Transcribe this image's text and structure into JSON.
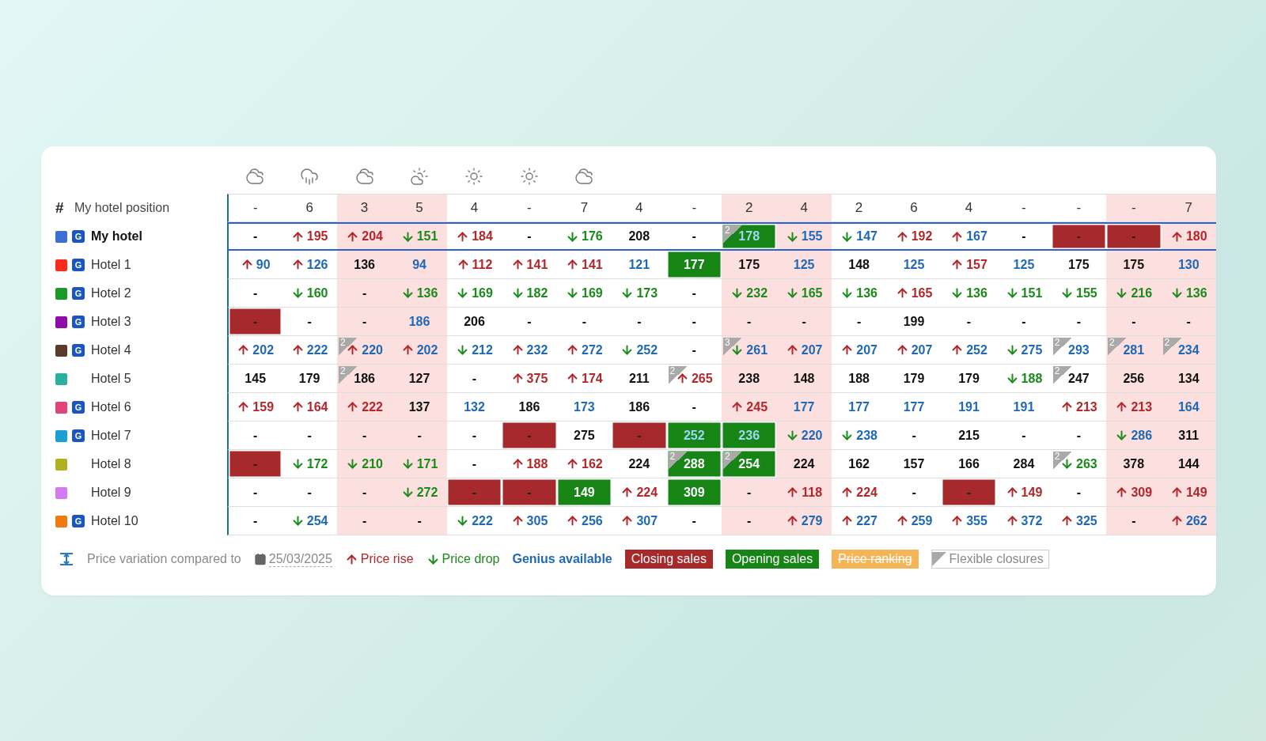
{
  "weather": [
    {
      "kind": "cloudy"
    },
    {
      "kind": "rain"
    },
    {
      "kind": "cloudy"
    },
    {
      "kind": "sun-cloud"
    },
    {
      "kind": "sun"
    },
    {
      "kind": "sun"
    },
    {
      "kind": "cloudy"
    }
  ],
  "columns": [
    {
      "weekend": false
    },
    {
      "weekend": false
    },
    {
      "weekend": true
    },
    {
      "weekend": true
    },
    {
      "weekend": false
    },
    {
      "weekend": false
    },
    {
      "weekend": false
    },
    {
      "weekend": false
    },
    {
      "weekend": false
    },
    {
      "weekend": true
    },
    {
      "weekend": true
    },
    {
      "weekend": false
    },
    {
      "weekend": false
    },
    {
      "weekend": false
    },
    {
      "weekend": false
    },
    {
      "weekend": false
    },
    {
      "weekend": true
    },
    {
      "weekend": true
    }
  ],
  "position_row": {
    "symbol": "#",
    "label": "My hotel position",
    "values": [
      "-",
      "6",
      "3",
      "5",
      "4",
      "-",
      "7",
      "4",
      "-",
      "2",
      "4",
      "2",
      "6",
      "4",
      "-",
      "-",
      "-",
      "7"
    ]
  },
  "hotels": [
    {
      "name": "My hotel",
      "color": "#3b6fd6",
      "badge": "G",
      "highlighted": true,
      "cells": [
        {
          "price": "-",
          "rise": false,
          "drop": false,
          "genius": false,
          "closed": false,
          "opened": false
        },
        {
          "price": "195",
          "rise": true,
          "drop": false,
          "genius": false,
          "closed": false,
          "opened": false
        },
        {
          "price": "204",
          "rise": true,
          "drop": false,
          "genius": false,
          "closed": false,
          "opened": false
        },
        {
          "price": "151",
          "rise": false,
          "drop": true,
          "genius": false,
          "closed": false,
          "opened": false
        },
        {
          "price": "184",
          "rise": true,
          "drop": false,
          "genius": false,
          "closed": false,
          "opened": false
        },
        {
          "price": "-",
          "rise": false,
          "drop": false,
          "genius": false,
          "closed": false,
          "opened": false
        },
        {
          "price": "176",
          "rise": false,
          "drop": true,
          "genius": false,
          "closed": false,
          "opened": false
        },
        {
          "price": "208",
          "rise": false,
          "drop": false,
          "genius": false,
          "closed": false,
          "opened": false
        },
        {
          "price": "-",
          "rise": false,
          "drop": false,
          "genius": false,
          "closed": false,
          "opened": false
        },
        {
          "price": "178",
          "rise": false,
          "drop": false,
          "genius": true,
          "closed": false,
          "opened": true,
          "flex": "2"
        },
        {
          "price": "155",
          "rise": false,
          "drop": true,
          "genius": true,
          "closed": false,
          "opened": false
        },
        {
          "price": "147",
          "rise": false,
          "drop": true,
          "genius": true,
          "closed": false,
          "opened": false
        },
        {
          "price": "192",
          "rise": true,
          "drop": false,
          "genius": false,
          "closed": false,
          "opened": false
        },
        {
          "price": "167",
          "rise": true,
          "drop": false,
          "genius": true,
          "closed": false,
          "opened": false
        },
        {
          "price": "-",
          "rise": false,
          "drop": false,
          "genius": false,
          "closed": false,
          "opened": false
        },
        {
          "price": "-",
          "rise": false,
          "drop": false,
          "genius": false,
          "closed": true,
          "opened": false
        },
        {
          "price": "-",
          "rise": false,
          "drop": false,
          "genius": false,
          "closed": true,
          "opened": false
        },
        {
          "price": "180",
          "rise": true,
          "drop": false,
          "genius": false,
          "closed": false,
          "opened": false
        }
      ]
    },
    {
      "name": "Hotel 1",
      "color": "#ff2a1a",
      "badge": "G",
      "highlighted": false,
      "cells": [
        {
          "price": "90",
          "rise": true,
          "drop": false,
          "genius": true,
          "closed": false,
          "opened": false
        },
        {
          "price": "126",
          "rise": true,
          "drop": false,
          "genius": true,
          "closed": false,
          "opened": false
        },
        {
          "price": "136",
          "rise": false,
          "drop": false,
          "genius": false,
          "closed": false,
          "opened": false
        },
        {
          "price": "94",
          "rise": false,
          "drop": false,
          "genius": true,
          "closed": false,
          "opened": false
        },
        {
          "price": "112",
          "rise": true,
          "drop": false,
          "genius": false,
          "closed": false,
          "opened": false
        },
        {
          "price": "141",
          "rise": true,
          "drop": false,
          "genius": false,
          "closed": false,
          "opened": false
        },
        {
          "price": "141",
          "rise": true,
          "drop": false,
          "genius": false,
          "closed": false,
          "opened": false
        },
        {
          "price": "121",
          "rise": false,
          "drop": false,
          "genius": true,
          "closed": false,
          "opened": false
        },
        {
          "price": "177",
          "rise": false,
          "drop": false,
          "genius": false,
          "closed": false,
          "opened": true
        },
        {
          "price": "175",
          "rise": false,
          "drop": false,
          "genius": false,
          "closed": false,
          "opened": false
        },
        {
          "price": "125",
          "rise": false,
          "drop": false,
          "genius": true,
          "closed": false,
          "opened": false
        },
        {
          "price": "148",
          "rise": false,
          "drop": false,
          "genius": false,
          "closed": false,
          "opened": false
        },
        {
          "price": "125",
          "rise": false,
          "drop": false,
          "genius": true,
          "closed": false,
          "opened": false
        },
        {
          "price": "157",
          "rise": true,
          "drop": false,
          "genius": false,
          "closed": false,
          "opened": false
        },
        {
          "price": "125",
          "rise": false,
          "drop": false,
          "genius": true,
          "closed": false,
          "opened": false
        },
        {
          "price": "175",
          "rise": false,
          "drop": false,
          "genius": false,
          "closed": false,
          "opened": false
        },
        {
          "price": "175",
          "rise": false,
          "drop": false,
          "genius": false,
          "closed": false,
          "opened": false
        },
        {
          "price": "130",
          "rise": false,
          "drop": false,
          "genius": true,
          "closed": false,
          "opened": false
        }
      ]
    },
    {
      "name": "Hotel 2",
      "color": "#1a9a28",
      "badge": "G",
      "highlighted": false,
      "cells": [
        {
          "price": "-",
          "rise": false,
          "drop": false,
          "genius": false,
          "closed": false,
          "opened": false
        },
        {
          "price": "160",
          "rise": false,
          "drop": true,
          "genius": false,
          "closed": false,
          "opened": false
        },
        {
          "price": "-",
          "rise": false,
          "drop": false,
          "genius": false,
          "closed": false,
          "opened": false
        },
        {
          "price": "136",
          "rise": false,
          "drop": true,
          "genius": false,
          "closed": false,
          "opened": false
        },
        {
          "price": "169",
          "rise": false,
          "drop": true,
          "genius": false,
          "closed": false,
          "opened": false
        },
        {
          "price": "182",
          "rise": false,
          "drop": true,
          "genius": false,
          "closed": false,
          "opened": false
        },
        {
          "price": "169",
          "rise": false,
          "drop": true,
          "genius": false,
          "closed": false,
          "opened": false
        },
        {
          "price": "173",
          "rise": false,
          "drop": true,
          "genius": false,
          "closed": false,
          "opened": false
        },
        {
          "price": "-",
          "rise": false,
          "drop": false,
          "genius": false,
          "closed": false,
          "opened": false
        },
        {
          "price": "232",
          "rise": false,
          "drop": true,
          "genius": false,
          "closed": false,
          "opened": false
        },
        {
          "price": "165",
          "rise": false,
          "drop": true,
          "genius": false,
          "closed": false,
          "opened": false
        },
        {
          "price": "136",
          "rise": false,
          "drop": true,
          "genius": false,
          "closed": false,
          "opened": false
        },
        {
          "price": "165",
          "rise": true,
          "drop": false,
          "genius": false,
          "closed": false,
          "opened": false
        },
        {
          "price": "136",
          "rise": false,
          "drop": true,
          "genius": false,
          "closed": false,
          "opened": false
        },
        {
          "price": "151",
          "rise": false,
          "drop": true,
          "genius": false,
          "closed": false,
          "opened": false
        },
        {
          "price": "155",
          "rise": false,
          "drop": true,
          "genius": false,
          "closed": false,
          "opened": false
        },
        {
          "price": "216",
          "rise": false,
          "drop": true,
          "genius": false,
          "closed": false,
          "opened": false
        },
        {
          "price": "136",
          "rise": false,
          "drop": true,
          "genius": false,
          "closed": false,
          "opened": false
        }
      ]
    },
    {
      "name": "Hotel 3",
      "color": "#8e0ca8",
      "badge": "G",
      "highlighted": false,
      "cells": [
        {
          "price": "-",
          "rise": false,
          "drop": false,
          "genius": false,
          "closed": true,
          "opened": false
        },
        {
          "price": "-",
          "rise": false,
          "drop": false,
          "genius": false,
          "closed": false,
          "opened": false
        },
        {
          "price": "-",
          "rise": false,
          "drop": false,
          "genius": false,
          "closed": false,
          "opened": false
        },
        {
          "price": "186",
          "rise": false,
          "drop": false,
          "genius": true,
          "closed": false,
          "opened": false
        },
        {
          "price": "206",
          "rise": false,
          "drop": false,
          "genius": false,
          "closed": false,
          "opened": false
        },
        {
          "price": "-",
          "rise": false,
          "drop": false,
          "genius": false,
          "closed": false,
          "opened": false
        },
        {
          "price": "-",
          "rise": false,
          "drop": false,
          "genius": false,
          "closed": false,
          "opened": false
        },
        {
          "price": "-",
          "rise": false,
          "drop": false,
          "genius": false,
          "closed": false,
          "opened": false
        },
        {
          "price": "-",
          "rise": false,
          "drop": false,
          "genius": false,
          "closed": false,
          "opened": false
        },
        {
          "price": "-",
          "rise": false,
          "drop": false,
          "genius": false,
          "closed": false,
          "opened": false
        },
        {
          "price": "-",
          "rise": false,
          "drop": false,
          "genius": false,
          "closed": false,
          "opened": false
        },
        {
          "price": "-",
          "rise": false,
          "drop": false,
          "genius": false,
          "closed": false,
          "opened": false
        },
        {
          "price": "199",
          "rise": false,
          "drop": false,
          "genius": false,
          "closed": false,
          "opened": false
        },
        {
          "price": "-",
          "rise": false,
          "drop": false,
          "genius": false,
          "closed": false,
          "opened": false
        },
        {
          "price": "-",
          "rise": false,
          "drop": false,
          "genius": false,
          "closed": false,
          "opened": false
        },
        {
          "price": "-",
          "rise": false,
          "drop": false,
          "genius": false,
          "closed": false,
          "opened": false
        },
        {
          "price": "-",
          "rise": false,
          "drop": false,
          "genius": false,
          "closed": false,
          "opened": false
        },
        {
          "price": "-",
          "rise": false,
          "drop": false,
          "genius": false,
          "closed": false,
          "opened": false
        }
      ]
    },
    {
      "name": "Hotel 4",
      "color": "#5a3a2a",
      "badge": "G",
      "highlighted": false,
      "cells": [
        {
          "price": "202",
          "rise": true,
          "drop": false,
          "genius": true,
          "closed": false,
          "opened": false
        },
        {
          "price": "222",
          "rise": true,
          "drop": false,
          "genius": true,
          "closed": false,
          "opened": false
        },
        {
          "price": "220",
          "rise": true,
          "drop": false,
          "genius": true,
          "closed": false,
          "opened": false,
          "flex": "2"
        },
        {
          "price": "202",
          "rise": true,
          "drop": false,
          "genius": true,
          "closed": false,
          "opened": false
        },
        {
          "price": "212",
          "rise": false,
          "drop": true,
          "genius": true,
          "closed": false,
          "opened": false
        },
        {
          "price": "232",
          "rise": true,
          "drop": false,
          "genius": true,
          "closed": false,
          "opened": false
        },
        {
          "price": "272",
          "rise": true,
          "drop": false,
          "genius": true,
          "closed": false,
          "opened": false
        },
        {
          "price": "252",
          "rise": false,
          "drop": true,
          "genius": true,
          "closed": false,
          "opened": false
        },
        {
          "price": "-",
          "rise": false,
          "drop": false,
          "genius": false,
          "closed": false,
          "opened": false
        },
        {
          "price": "261",
          "rise": false,
          "drop": true,
          "genius": true,
          "closed": false,
          "opened": false,
          "flex": "3"
        },
        {
          "price": "207",
          "rise": true,
          "drop": false,
          "genius": true,
          "closed": false,
          "opened": false
        },
        {
          "price": "207",
          "rise": true,
          "drop": false,
          "genius": true,
          "closed": false,
          "opened": false
        },
        {
          "price": "207",
          "rise": true,
          "drop": false,
          "genius": true,
          "closed": false,
          "opened": false
        },
        {
          "price": "252",
          "rise": true,
          "drop": false,
          "genius": true,
          "closed": false,
          "opened": false
        },
        {
          "price": "275",
          "rise": false,
          "drop": true,
          "genius": true,
          "closed": false,
          "opened": false
        },
        {
          "price": "293",
          "rise": false,
          "drop": false,
          "genius": true,
          "closed": false,
          "opened": false,
          "flex": "2"
        },
        {
          "price": "281",
          "rise": false,
          "drop": false,
          "genius": true,
          "closed": false,
          "opened": false,
          "flex": "2"
        },
        {
          "price": "234",
          "rise": false,
          "drop": false,
          "genius": true,
          "closed": false,
          "opened": false,
          "flex": "2"
        }
      ]
    },
    {
      "name": "Hotel 5",
      "color": "#2ab0a0",
      "highlighted": false,
      "cells": [
        {
          "price": "145",
          "rise": false,
          "drop": false,
          "genius": false,
          "closed": false,
          "opened": false
        },
        {
          "price": "179",
          "rise": false,
          "drop": false,
          "genius": false,
          "closed": false,
          "opened": false
        },
        {
          "price": "186",
          "rise": false,
          "drop": false,
          "genius": false,
          "closed": false,
          "opened": false,
          "flex": "2"
        },
        {
          "price": "127",
          "rise": false,
          "drop": false,
          "genius": false,
          "closed": false,
          "opened": false
        },
        {
          "price": "-",
          "rise": false,
          "drop": false,
          "genius": false,
          "closed": false,
          "opened": false
        },
        {
          "price": "375",
          "rise": true,
          "drop": false,
          "genius": false,
          "closed": false,
          "opened": false
        },
        {
          "price": "174",
          "rise": true,
          "drop": false,
          "genius": false,
          "closed": false,
          "opened": false
        },
        {
          "price": "211",
          "rise": false,
          "drop": false,
          "genius": false,
          "closed": false,
          "opened": false
        },
        {
          "price": "265",
          "rise": true,
          "drop": false,
          "genius": false,
          "closed": false,
          "opened": false,
          "flex": "2"
        },
        {
          "price": "238",
          "rise": false,
          "drop": false,
          "genius": false,
          "closed": false,
          "opened": false
        },
        {
          "price": "148",
          "rise": false,
          "drop": false,
          "genius": false,
          "closed": false,
          "opened": false
        },
        {
          "price": "188",
          "rise": false,
          "drop": false,
          "genius": false,
          "closed": false,
          "opened": false
        },
        {
          "price": "179",
          "rise": false,
          "drop": false,
          "genius": false,
          "closed": false,
          "opened": false
        },
        {
          "price": "179",
          "rise": false,
          "drop": false,
          "genius": false,
          "closed": false,
          "opened": false
        },
        {
          "price": "188",
          "rise": false,
          "drop": true,
          "genius": false,
          "closed": false,
          "opened": false
        },
        {
          "price": "247",
          "rise": false,
          "drop": false,
          "genius": false,
          "closed": false,
          "opened": false,
          "flex": "2"
        },
        {
          "price": "256",
          "rise": false,
          "drop": false,
          "genius": false,
          "closed": false,
          "opened": false
        },
        {
          "price": "134",
          "rise": false,
          "drop": false,
          "genius": false,
          "closed": false,
          "opened": false
        }
      ]
    },
    {
      "name": "Hotel 6",
      "color": "#e0457a",
      "badge": "G",
      "highlighted": false,
      "cells": [
        {
          "price": "159",
          "rise": true,
          "drop": false,
          "genius": false,
          "closed": false,
          "opened": false
        },
        {
          "price": "164",
          "rise": true,
          "drop": false,
          "genius": false,
          "closed": false,
          "opened": false
        },
        {
          "price": "222",
          "rise": true,
          "drop": false,
          "genius": false,
          "closed": false,
          "opened": false
        },
        {
          "price": "137",
          "rise": false,
          "drop": false,
          "genius": false,
          "closed": false,
          "opened": false
        },
        {
          "price": "132",
          "rise": false,
          "drop": false,
          "genius": true,
          "closed": false,
          "opened": false
        },
        {
          "price": "186",
          "rise": false,
          "drop": false,
          "genius": false,
          "closed": false,
          "opened": false
        },
        {
          "price": "173",
          "rise": false,
          "drop": false,
          "genius": true,
          "closed": false,
          "opened": false
        },
        {
          "price": "186",
          "rise": false,
          "drop": false,
          "genius": false,
          "closed": false,
          "opened": false
        },
        {
          "price": "-",
          "rise": false,
          "drop": false,
          "genius": false,
          "closed": false,
          "opened": false
        },
        {
          "price": "245",
          "rise": true,
          "drop": false,
          "genius": false,
          "closed": false,
          "opened": false
        },
        {
          "price": "177",
          "rise": false,
          "drop": false,
          "genius": true,
          "closed": false,
          "opened": false
        },
        {
          "price": "177",
          "rise": false,
          "drop": false,
          "genius": true,
          "closed": false,
          "opened": false
        },
        {
          "price": "177",
          "rise": false,
          "drop": false,
          "genius": true,
          "closed": false,
          "opened": false
        },
        {
          "price": "191",
          "rise": false,
          "drop": false,
          "genius": true,
          "closed": false,
          "opened": false
        },
        {
          "price": "191",
          "rise": false,
          "drop": false,
          "genius": true,
          "closed": false,
          "opened": false
        },
        {
          "price": "213",
          "rise": true,
          "drop": false,
          "genius": false,
          "closed": false,
          "opened": false
        },
        {
          "price": "213",
          "rise": true,
          "drop": false,
          "genius": false,
          "closed": false,
          "opened": false
        },
        {
          "price": "164",
          "rise": false,
          "drop": false,
          "genius": true,
          "closed": false,
          "opened": false
        }
      ]
    },
    {
      "name": "Hotel 7",
      "color": "#1aa0d0",
      "badge": "G",
      "highlighted": false,
      "cells": [
        {
          "price": "-",
          "rise": false,
          "drop": false,
          "genius": false,
          "closed": false,
          "opened": false
        },
        {
          "price": "-",
          "rise": false,
          "drop": false,
          "genius": false,
          "closed": false,
          "opened": false
        },
        {
          "price": "-",
          "rise": false,
          "drop": false,
          "genius": false,
          "closed": false,
          "opened": false
        },
        {
          "price": "-",
          "rise": false,
          "drop": false,
          "genius": false,
          "closed": false,
          "opened": false
        },
        {
          "price": "-",
          "rise": false,
          "drop": false,
          "genius": false,
          "closed": false,
          "opened": false
        },
        {
          "price": "-",
          "rise": false,
          "drop": false,
          "genius": false,
          "closed": true,
          "opened": false
        },
        {
          "price": "275",
          "rise": false,
          "drop": false,
          "genius": false,
          "closed": false,
          "opened": false
        },
        {
          "price": "-",
          "rise": false,
          "drop": false,
          "genius": false,
          "closed": true,
          "opened": false
        },
        {
          "price": "252",
          "rise": false,
          "drop": false,
          "genius": true,
          "closed": false,
          "opened": true
        },
        {
          "price": "236",
          "rise": false,
          "drop": false,
          "genius": true,
          "closed": false,
          "opened": true
        },
        {
          "price": "220",
          "rise": false,
          "drop": true,
          "genius": true,
          "closed": false,
          "opened": false
        },
        {
          "price": "238",
          "rise": false,
          "drop": true,
          "genius": true,
          "closed": false,
          "opened": false
        },
        {
          "price": "-",
          "rise": false,
          "drop": false,
          "genius": false,
          "closed": false,
          "opened": false
        },
        {
          "price": "215",
          "rise": false,
          "drop": false,
          "genius": false,
          "closed": false,
          "opened": false
        },
        {
          "price": "-",
          "rise": false,
          "drop": false,
          "genius": false,
          "closed": false,
          "opened": false
        },
        {
          "price": "-",
          "rise": false,
          "drop": false,
          "genius": false,
          "closed": false,
          "opened": false
        },
        {
          "price": "286",
          "rise": false,
          "drop": true,
          "genius": true,
          "closed": false,
          "opened": false
        },
        {
          "price": "311",
          "rise": false,
          "drop": false,
          "genius": false,
          "closed": false,
          "opened": false
        }
      ]
    },
    {
      "name": "Hotel 8",
      "color": "#b0b020",
      "highlighted": false,
      "cells": [
        {
          "price": "-",
          "rise": false,
          "drop": false,
          "genius": false,
          "closed": true,
          "opened": false
        },
        {
          "price": "172",
          "rise": false,
          "drop": true,
          "genius": false,
          "closed": false,
          "opened": false
        },
        {
          "price": "210",
          "rise": false,
          "drop": true,
          "genius": false,
          "closed": false,
          "opened": false
        },
        {
          "price": "171",
          "rise": false,
          "drop": true,
          "genius": false,
          "closed": false,
          "opened": false
        },
        {
          "price": "-",
          "rise": false,
          "drop": false,
          "genius": false,
          "closed": false,
          "opened": false
        },
        {
          "price": "188",
          "rise": true,
          "drop": false,
          "genius": false,
          "closed": false,
          "opened": false
        },
        {
          "price": "162",
          "rise": true,
          "drop": false,
          "genius": false,
          "closed": false,
          "opened": false
        },
        {
          "price": "224",
          "rise": false,
          "drop": false,
          "genius": false,
          "closed": false,
          "opened": false
        },
        {
          "price": "288",
          "rise": false,
          "drop": false,
          "genius": false,
          "closed": false,
          "opened": true,
          "flex": "2"
        },
        {
          "price": "254",
          "rise": false,
          "drop": false,
          "genius": false,
          "closed": false,
          "opened": true,
          "flex": "2"
        },
        {
          "price": "224",
          "rise": false,
          "drop": false,
          "genius": false,
          "closed": false,
          "opened": false
        },
        {
          "price": "162",
          "rise": false,
          "drop": false,
          "genius": false,
          "closed": false,
          "opened": false
        },
        {
          "price": "157",
          "rise": false,
          "drop": false,
          "genius": false,
          "closed": false,
          "opened": false
        },
        {
          "price": "166",
          "rise": false,
          "drop": false,
          "genius": false,
          "closed": false,
          "opened": false
        },
        {
          "price": "284",
          "rise": false,
          "drop": false,
          "genius": false,
          "closed": false,
          "opened": false
        },
        {
          "price": "263",
          "rise": false,
          "drop": true,
          "genius": false,
          "closed": false,
          "opened": false,
          "flex": "2"
        },
        {
          "price": "378",
          "rise": false,
          "drop": false,
          "genius": false,
          "closed": false,
          "opened": false
        },
        {
          "price": "144",
          "rise": false,
          "drop": false,
          "genius": false,
          "closed": false,
          "opened": false
        }
      ]
    },
    {
      "name": "Hotel 9",
      "color": "#d47af0",
      "highlighted": false,
      "cells": [
        {
          "price": "-",
          "rise": false,
          "drop": false,
          "genius": false,
          "closed": false,
          "opened": false
        },
        {
          "price": "-",
          "rise": false,
          "drop": false,
          "genius": false,
          "closed": false,
          "opened": false
        },
        {
          "price": "-",
          "rise": false,
          "drop": false,
          "genius": false,
          "closed": false,
          "opened": false
        },
        {
          "price": "272",
          "rise": false,
          "drop": true,
          "genius": false,
          "closed": false,
          "opened": false
        },
        {
          "price": "-",
          "rise": false,
          "drop": false,
          "genius": false,
          "closed": true,
          "opened": false
        },
        {
          "price": "-",
          "rise": false,
          "drop": false,
          "genius": false,
          "closed": true,
          "opened": false
        },
        {
          "price": "149",
          "rise": false,
          "drop": false,
          "genius": false,
          "closed": false,
          "opened": true
        },
        {
          "price": "224",
          "rise": true,
          "drop": false,
          "genius": false,
          "closed": false,
          "opened": false
        },
        {
          "price": "309",
          "rise": false,
          "drop": false,
          "genius": false,
          "closed": false,
          "opened": true
        },
        {
          "price": "-",
          "rise": false,
          "drop": false,
          "genius": false,
          "closed": false,
          "opened": false
        },
        {
          "price": "118",
          "rise": true,
          "drop": false,
          "genius": false,
          "closed": false,
          "opened": false
        },
        {
          "price": "224",
          "rise": true,
          "drop": false,
          "genius": false,
          "closed": false,
          "opened": false
        },
        {
          "price": "-",
          "rise": false,
          "drop": false,
          "genius": false,
          "closed": false,
          "opened": false
        },
        {
          "price": "-",
          "rise": false,
          "drop": false,
          "genius": false,
          "closed": true,
          "opened": false
        },
        {
          "price": "149",
          "rise": true,
          "drop": false,
          "genius": false,
          "closed": false,
          "opened": false
        },
        {
          "price": "-",
          "rise": false,
          "drop": false,
          "genius": false,
          "closed": false,
          "opened": false
        },
        {
          "price": "309",
          "rise": true,
          "drop": false,
          "genius": false,
          "closed": false,
          "opened": false
        },
        {
          "price": "149",
          "rise": true,
          "drop": false,
          "genius": false,
          "closed": false,
          "opened": false
        }
      ]
    },
    {
      "name": "Hotel 10",
      "color": "#f07a10",
      "badge": "G",
      "highlighted": false,
      "cells": [
        {
          "price": "-",
          "rise": false,
          "drop": false,
          "genius": false,
          "closed": false,
          "opened": false
        },
        {
          "price": "254",
          "rise": false,
          "drop": true,
          "genius": true,
          "closed": false,
          "opened": false
        },
        {
          "price": "-",
          "rise": false,
          "drop": false,
          "genius": false,
          "closed": false,
          "opened": false
        },
        {
          "price": "-",
          "rise": false,
          "drop": false,
          "genius": false,
          "closed": false,
          "opened": false
        },
        {
          "price": "222",
          "rise": false,
          "drop": true,
          "genius": true,
          "closed": false,
          "opened": false
        },
        {
          "price": "305",
          "rise": true,
          "drop": false,
          "genius": true,
          "closed": false,
          "opened": false
        },
        {
          "price": "256",
          "rise": true,
          "drop": false,
          "genius": true,
          "closed": false,
          "opened": false
        },
        {
          "price": "307",
          "rise": true,
          "drop": false,
          "genius": true,
          "closed": false,
          "opened": false
        },
        {
          "price": "-",
          "rise": false,
          "drop": false,
          "genius": false,
          "closed": false,
          "opened": false
        },
        {
          "price": "-",
          "rise": false,
          "drop": false,
          "genius": false,
          "closed": false,
          "opened": false
        },
        {
          "price": "279",
          "rise": true,
          "drop": false,
          "genius": true,
          "closed": false,
          "opened": false
        },
        {
          "price": "227",
          "rise": true,
          "drop": false,
          "genius": true,
          "closed": false,
          "opened": false
        },
        {
          "price": "259",
          "rise": true,
          "drop": false,
          "genius": true,
          "closed": false,
          "opened": false
        },
        {
          "price": "355",
          "rise": true,
          "drop": false,
          "genius": true,
          "closed": false,
          "opened": false
        },
        {
          "price": "372",
          "rise": true,
          "drop": false,
          "genius": true,
          "closed": false,
          "opened": false
        },
        {
          "price": "325",
          "rise": true,
          "drop": false,
          "genius": true,
          "closed": false,
          "opened": false
        },
        {
          "price": "-",
          "rise": false,
          "drop": false,
          "genius": false,
          "closed": false,
          "opened": false
        },
        {
          "price": "262",
          "rise": true,
          "drop": false,
          "genius": true,
          "closed": false,
          "opened": false
        }
      ]
    }
  ],
  "legend": {
    "title": "Price variation compared to",
    "date": "25/03/2025",
    "items": [
      {
        "kind": "rise",
        "label": "Price rise",
        "active": true
      },
      {
        "kind": "drop",
        "label": "Price drop",
        "active": true
      },
      {
        "kind": "genius",
        "label": "Genius available",
        "active": true
      },
      {
        "kind": "closing",
        "label": "Closing sales",
        "active": true
      },
      {
        "kind": "opening",
        "label": "Opening sales",
        "active": true
      },
      {
        "kind": "ranking",
        "label": "Price ranking",
        "active": false
      },
      {
        "kind": "flexible",
        "label": "Flexible closures",
        "active": true
      }
    ]
  }
}
